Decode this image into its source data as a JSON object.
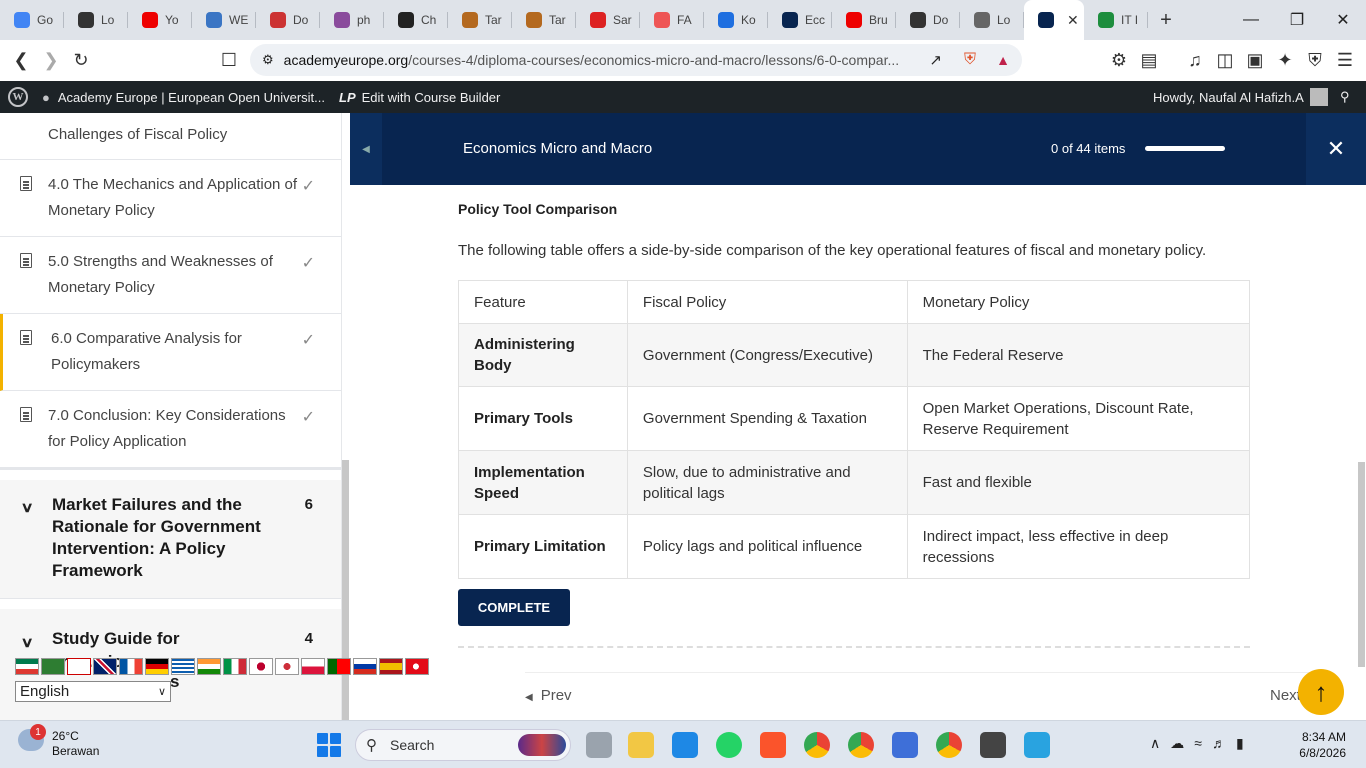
{
  "browser": {
    "tabs": [
      {
        "label": "Go",
        "color": "#4285f4"
      },
      {
        "label": "Lo",
        "color": "#333"
      },
      {
        "label": "Yo",
        "color": "#e00"
      },
      {
        "label": "WE",
        "color": "#3a75c4"
      },
      {
        "label": "Do",
        "color": "#c33"
      },
      {
        "label": "ph",
        "color": "#8a4b9c"
      },
      {
        "label": "Ch",
        "color": "#222"
      },
      {
        "label": "Tar",
        "color": "#b4691f"
      },
      {
        "label": "Tar",
        "color": "#b4691f"
      },
      {
        "label": "Sar",
        "color": "#d22"
      },
      {
        "label": "FA",
        "color": "#e55"
      },
      {
        "label": "Ko",
        "color": "#1f6fe0"
      },
      {
        "label": "Ecc",
        "color": "#082550"
      },
      {
        "label": "Bru",
        "color": "#e00"
      },
      {
        "label": "Do",
        "color": "#333"
      },
      {
        "label": "Lo",
        "color": "#666"
      }
    ],
    "active_tab_label": "",
    "last_tab_label": "IT I",
    "new_tab": "+",
    "url_domain": "academyeurope.org",
    "url_path": "/courses-4/diploma-courses/economics-micro-and-macro/lessons/6-0-compar..."
  },
  "wpbar": {
    "site_name": "Academy Europe | European Open Universit...",
    "edit_label": "Edit with Course Builder",
    "greeting": "Howdy, Naufal Al Hafizh.A"
  },
  "sidebar": {
    "items": [
      {
        "type": "lesson-partial",
        "label": "Challenges of Fiscal Policy"
      },
      {
        "type": "lesson",
        "label": "4.0 The Mechanics and Application of Monetary Policy",
        "check": "✓"
      },
      {
        "type": "lesson",
        "label": "5.0 Strengths and Weaknesses of Monetary Policy",
        "check": "✓"
      },
      {
        "type": "lesson",
        "label": "6.0 Comparative Analysis for Policymakers",
        "check": "✓"
      },
      {
        "type": "lesson",
        "label": "7.0 Conclusion: Key Considerations for Policy Application",
        "check": "✓"
      }
    ],
    "sections": [
      {
        "title": "Market Failures and the Rationale for Government Intervention: A Policy Framework",
        "count": "6"
      },
      {
        "title": "Study Guide for",
        "count": "4"
      }
    ],
    "overlap_text": "cro...mics",
    "overlap_tail": "s",
    "language": "English"
  },
  "course": {
    "title": "Economics Micro and Macro",
    "progress_text": "0 of 44 items",
    "progress_fraction": 0
  },
  "lesson": {
    "heading": "Policy Tool Comparison",
    "intro": "The following table offers a side-by-side comparison of the key operational features of fiscal and monetary policy.",
    "table": {
      "headers": [
        "Feature",
        "Fiscal Policy",
        "Monetary Policy"
      ],
      "rows": [
        [
          "Administering Body",
          "Government (Congress/Executive)",
          "The Federal Reserve"
        ],
        [
          "Primary Tools",
          "Government Spending & Taxation",
          "Open Market Operations, Discount Rate, Reserve Requirement"
        ],
        [
          "Implementation Speed",
          "Slow, due to administrative and political lags",
          "Fast and flexible"
        ],
        [
          "Primary Limitation",
          "Policy lags and political influence",
          "Indirect impact, less effective in deep recessions"
        ]
      ]
    },
    "complete_label": "COMPLETE",
    "prev_label": "Prev",
    "next_label": "Next"
  },
  "taskbar": {
    "weather_temp": "26°C",
    "weather_desc": "Berawan",
    "weather_badge": "1",
    "search_label": "Search",
    "time": "8:34 AM",
    "date": "6/8/2026"
  }
}
